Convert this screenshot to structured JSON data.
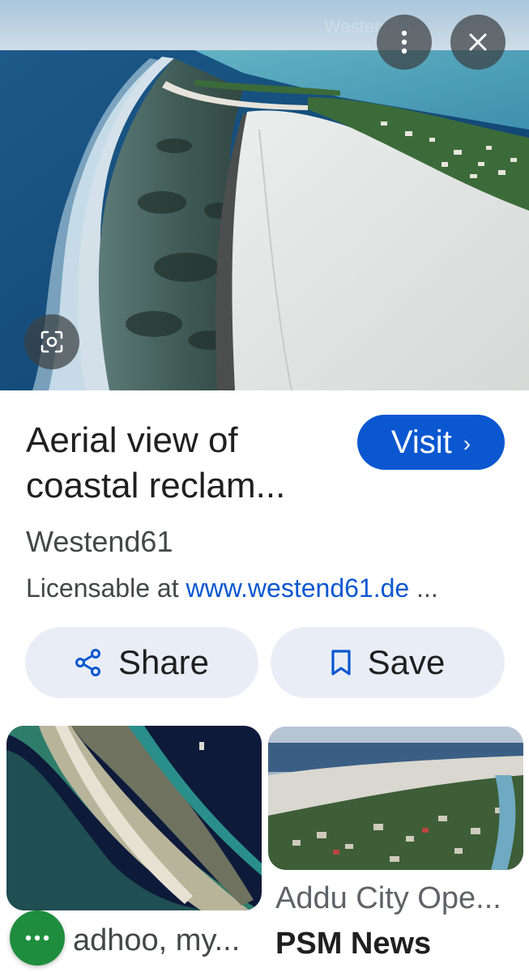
{
  "hero": {
    "watermark": "Westend61"
  },
  "header_buttons": {
    "more_icon": "more-vert-icon",
    "close_icon": "close-icon"
  },
  "lens_icon": "lens-icon",
  "result": {
    "title": "Aerial view of coastal reclam...",
    "visit_label": "Visit",
    "visit_chevron": "›",
    "source": "Westend61",
    "license_prefix": "Licensable at ",
    "license_link": "www.westend61.de",
    "license_suffix": " ..."
  },
  "actions": {
    "share_label": "Share",
    "save_label": "Save"
  },
  "related": [
    {
      "caption": "adhoo, my...",
      "source": ""
    },
    {
      "caption": "Addu City Ope...",
      "source": "PSM News"
    }
  ],
  "fab": {
    "icon": "more-horiz-icon"
  },
  "colors": {
    "accent": "#0b57d0",
    "pill_bg": "#e9eef6",
    "fab": "#1e8e3e"
  }
}
